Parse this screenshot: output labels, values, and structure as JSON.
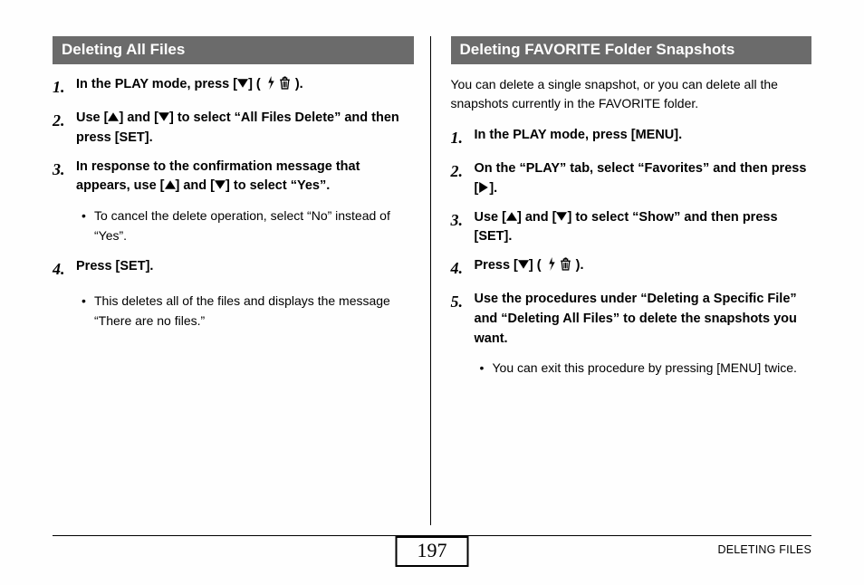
{
  "left": {
    "header": "Deleting All Files",
    "steps": [
      {
        "num": "1.",
        "text_before": "In the PLAY mode, press [",
        "tri": "down",
        "text_mid": "] ( ",
        "icons": [
          "flash",
          "trash"
        ],
        "text_after": " )."
      },
      {
        "num": "2.",
        "text_before": "Use [",
        "tri": "up",
        "text_mid": "] and [",
        "tri2": "down",
        "text_after": "] to select “All Files Delete” and then press [SET]."
      },
      {
        "num": "3.",
        "text_before": "In response to the confirmation message that appears, use [",
        "tri": "up",
        "text_mid": "] and [",
        "tri2": "down",
        "text_after": "] to select “Yes”."
      },
      {
        "num": "4.",
        "plain": "Press [SET]."
      }
    ],
    "bullets_after_3": [
      "To cancel the delete operation, select “No” instead of “Yes”."
    ],
    "bullets_after_4": [
      "This deletes all of the files and displays the message “There are no files.”"
    ]
  },
  "right": {
    "header": "Deleting FAVORITE Folder Snapshots",
    "intro": "You can delete a single snapshot, or you can delete all the snapshots currently in the FAVORITE folder.",
    "steps": [
      {
        "num": "1.",
        "plain": "In the PLAY mode, press [MENU]."
      },
      {
        "num": "2.",
        "text_before": "On the “PLAY” tab, select “Favorites” and then press [",
        "tri": "right",
        "text_after": "]."
      },
      {
        "num": "3.",
        "text_before": "Use [",
        "tri": "up",
        "text_mid": "] and [",
        "tri2": "down",
        "text_after": "] to select “Show” and then press [SET]."
      },
      {
        "num": "4.",
        "text_before": "Press [",
        "tri": "down",
        "text_mid": "] ( ",
        "icons": [
          "flash",
          "trash"
        ],
        "text_after": " )."
      },
      {
        "num": "5.",
        "plain": "Use the procedures under “Deleting a Specific File” and “Deleting All Files” to delete the snapshots you want."
      }
    ],
    "bullets_after_5": [
      "You can exit this procedure by pressing [MENU] twice."
    ]
  },
  "footer": {
    "page": "197",
    "label": "DELETING FILES"
  }
}
